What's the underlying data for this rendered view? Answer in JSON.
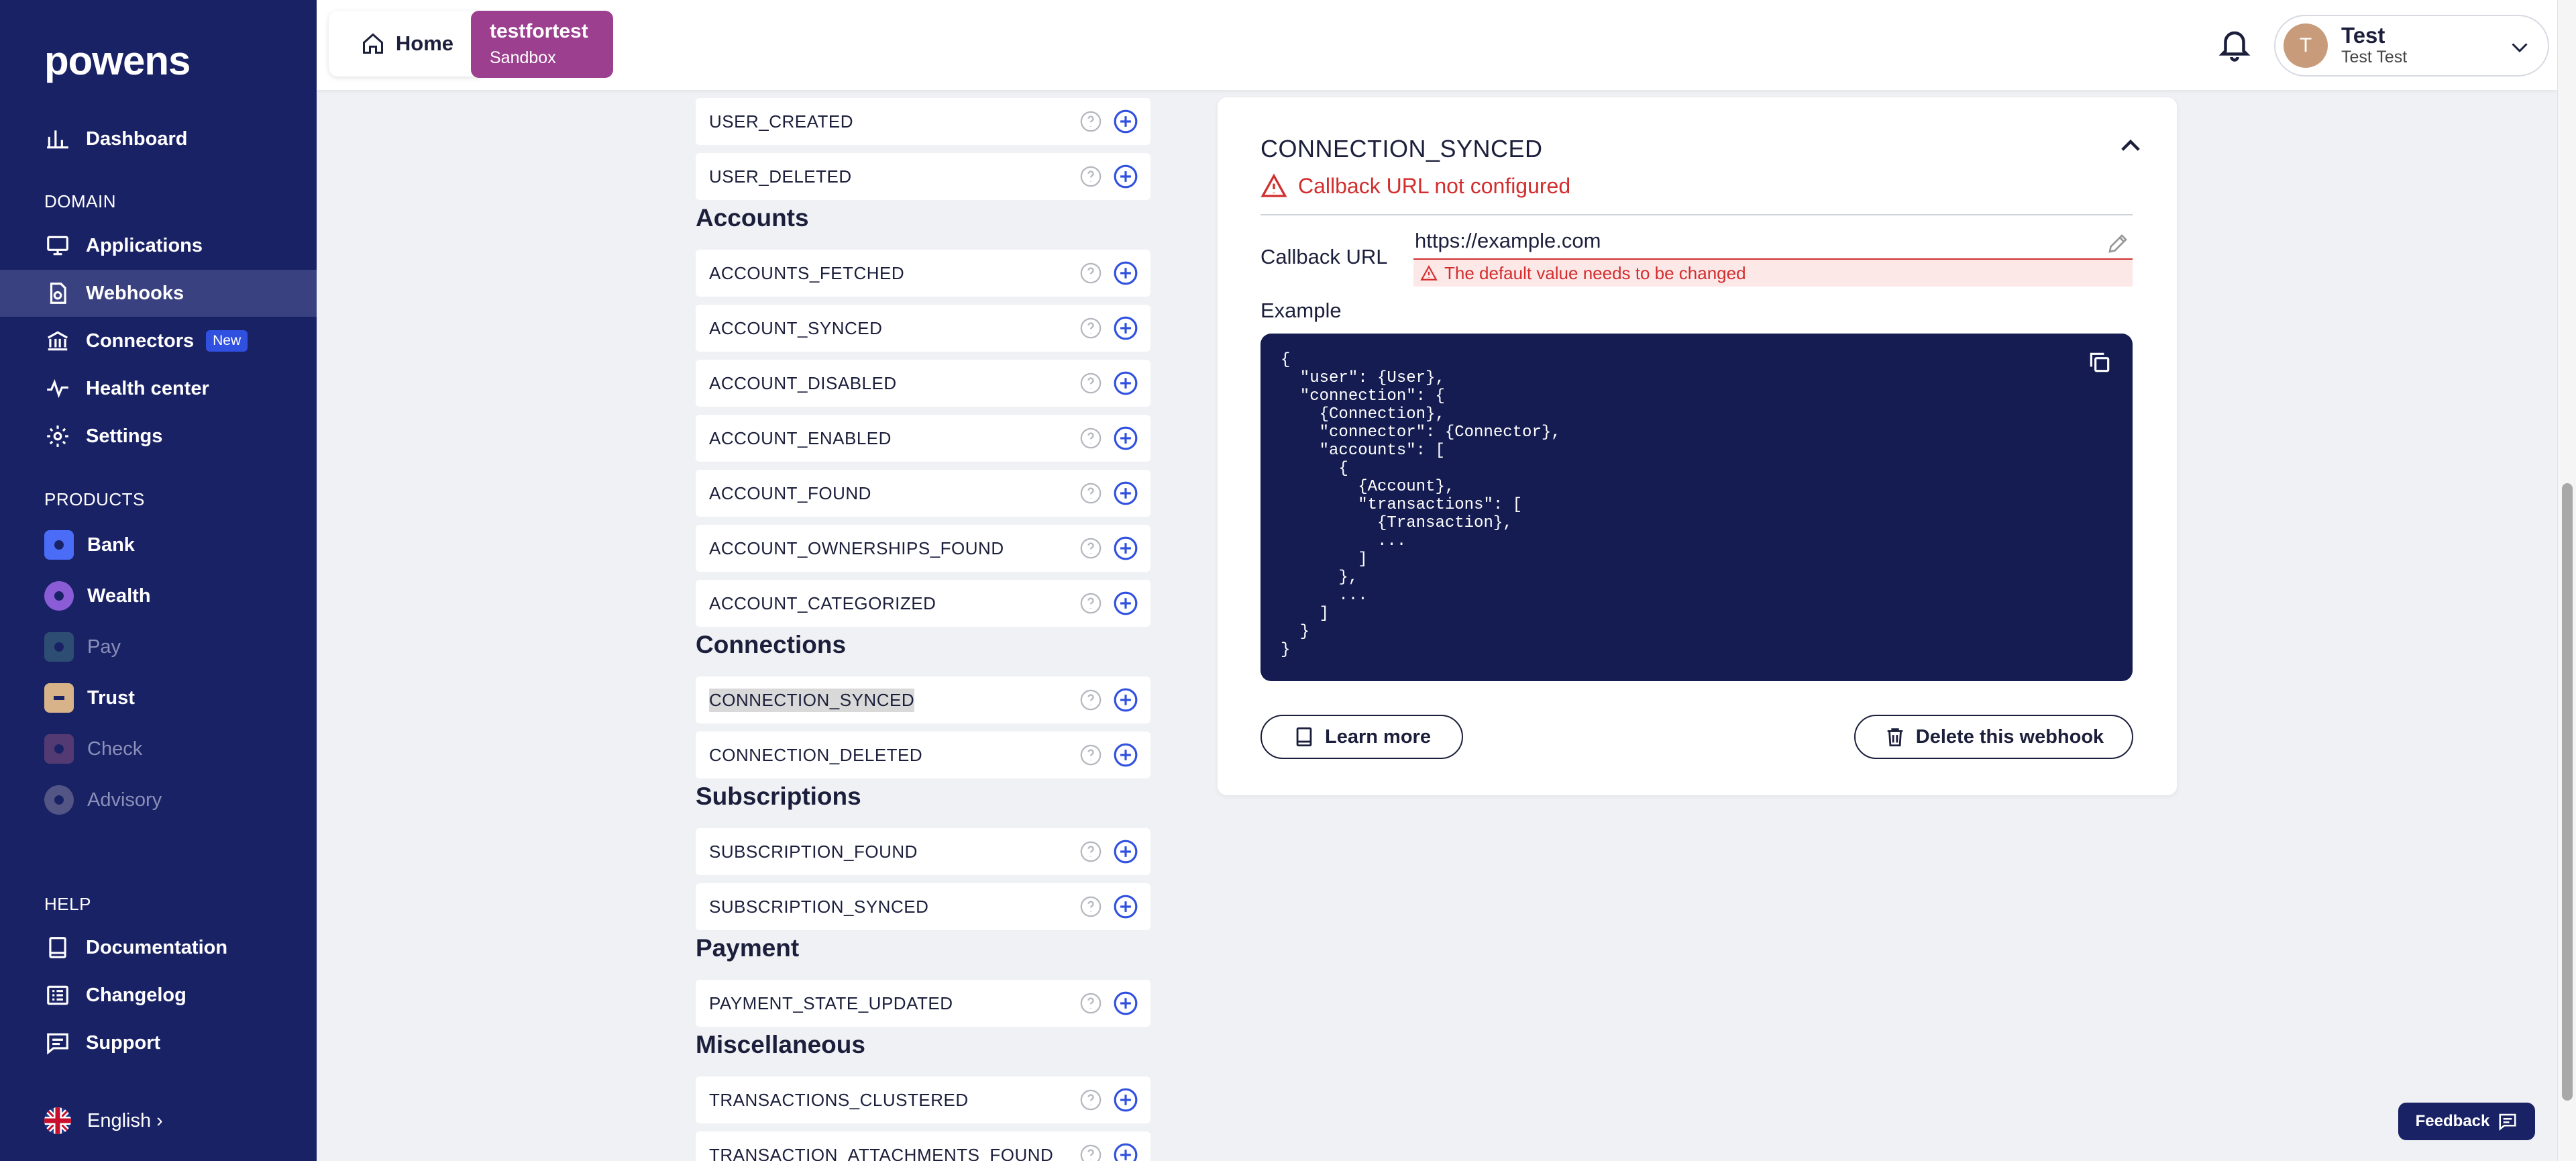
{
  "brand": {
    "logo_text": "powens"
  },
  "sidebar": {
    "nav": [
      {
        "label": "Dashboard",
        "icon": "bar-chart-icon"
      }
    ],
    "domain_title": "DOMAIN",
    "domain_items": [
      {
        "label": "Applications",
        "icon": "monitor-icon"
      },
      {
        "label": "Webhooks",
        "icon": "webhook-icon",
        "active": true
      },
      {
        "label": "Connectors",
        "icon": "bank-icon",
        "badge": "New"
      },
      {
        "label": "Health center",
        "icon": "pulse-icon"
      },
      {
        "label": "Settings",
        "icon": "gear-icon"
      }
    ],
    "products_title": "PRODUCTS",
    "products": [
      {
        "label": "Bank",
        "color": "#4a6cf7"
      },
      {
        "label": "Wealth",
        "color": "#8a5cd6"
      },
      {
        "label": "Pay",
        "color": "#3a7a8a"
      },
      {
        "label": "Trust",
        "color": "#d8b38a"
      },
      {
        "label": "Check",
        "color": "#7a4a7a"
      },
      {
        "label": "Advisory",
        "color": "#7a7a9a"
      }
    ],
    "help_title": "HELP",
    "help_items": [
      {
        "label": "Documentation",
        "icon": "book-icon"
      },
      {
        "label": "Changelog",
        "icon": "changelog-icon"
      },
      {
        "label": "Support",
        "icon": "chat-icon"
      }
    ],
    "language": "English"
  },
  "topbar": {
    "home_label": "Home",
    "env_name": "testfortest",
    "env_sub": "Sandbox",
    "user_initial": "T",
    "user_name": "Test",
    "user_sub": "Test Test"
  },
  "events": {
    "user_rows": [
      "USER_CREATED",
      "USER_DELETED"
    ],
    "groups": [
      {
        "title": "Accounts",
        "rows": [
          "ACCOUNTS_FETCHED",
          "ACCOUNT_SYNCED",
          "ACCOUNT_DISABLED",
          "ACCOUNT_ENABLED",
          "ACCOUNT_FOUND",
          "ACCOUNT_OWNERSHIPS_FOUND",
          "ACCOUNT_CATEGORIZED"
        ]
      },
      {
        "title": "Connections",
        "rows": [
          "CONNECTION_SYNCED",
          "CONNECTION_DELETED"
        ]
      },
      {
        "title": "Subscriptions",
        "rows": [
          "SUBSCRIPTION_FOUND",
          "SUBSCRIPTION_SYNCED"
        ]
      },
      {
        "title": "Payment",
        "rows": [
          "PAYMENT_STATE_UPDATED"
        ]
      },
      {
        "title": "Miscellaneous",
        "rows": [
          "TRANSACTIONS_CLUSTERED",
          "TRANSACTION_ATTACHMENTS_FOUND"
        ]
      }
    ],
    "selected": "CONNECTION_SYNCED"
  },
  "detail": {
    "title": "CONNECTION_SYNCED",
    "warning": "Callback URL not configured",
    "callback_label": "Callback URL",
    "callback_value": "https://example.com",
    "callback_error": "The default value needs to be changed",
    "example_label": "Example",
    "example_code": "{\n  \"user\": {User},\n  \"connection\": {\n    {Connection},\n    \"connector\": {Connector},\n    \"accounts\": [\n      {\n        {Account},\n        \"transactions\": [\n          {Transaction},\n          ...\n        ]\n      },\n      ...\n    ]\n  }\n}",
    "learn_more": "Learn more",
    "delete_label": "Delete this webhook"
  },
  "feedback_label": "Feedback",
  "colors": {
    "sidebar": "#1a2266",
    "active": "#3a4180",
    "accent": "#9b3f8e",
    "error": "#d22e2e",
    "link": "#3050e0"
  }
}
